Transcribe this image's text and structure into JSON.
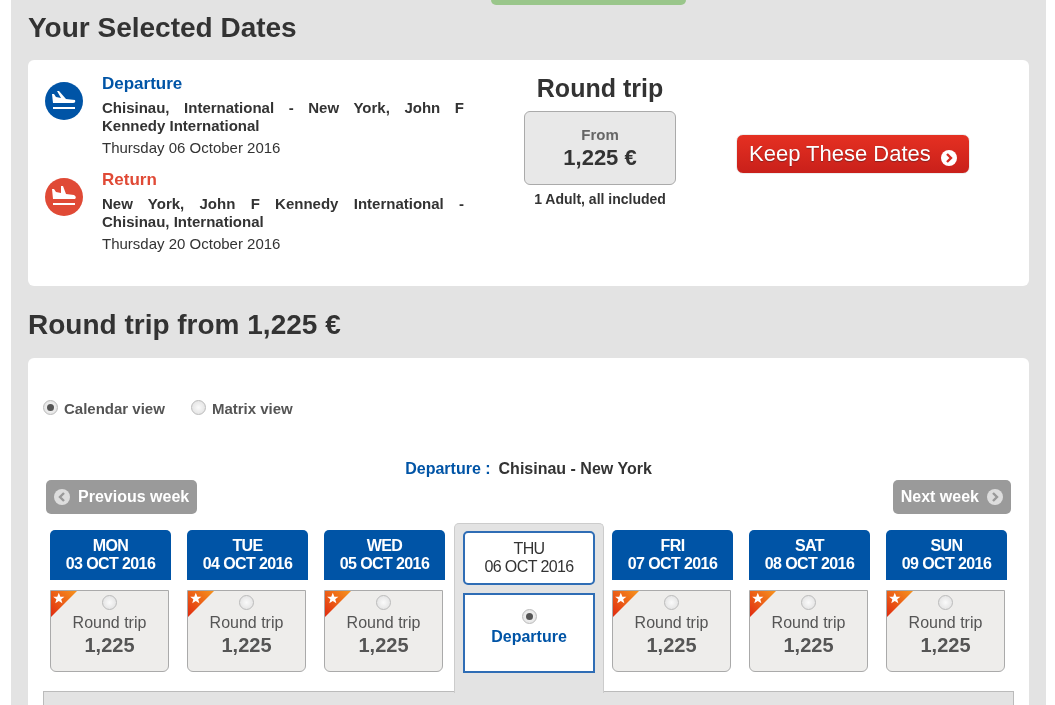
{
  "selected_dates": {
    "title": "Your Selected Dates",
    "legs": [
      {
        "kind": "departure",
        "label": "Departure",
        "route": "Chisinau, International - New York, John F Kennedy International",
        "date": "Thursday 06 October 2016"
      },
      {
        "kind": "return",
        "label": "Return",
        "route": "New York, John F Kennedy International - Chisinau, International",
        "date": "Thursday 20 October 2016"
      }
    ],
    "fare": {
      "title": "Round trip",
      "from_label": "From",
      "price": "1,225 €",
      "note": "1 Adult, all included"
    },
    "keep_button": "Keep These Dates"
  },
  "calendar": {
    "title": "Round trip from 1,225 €",
    "views": [
      {
        "label": "Calendar view",
        "selected": true
      },
      {
        "label": "Matrix view",
        "selected": false
      }
    ],
    "route_label": "Departure :",
    "route": "Chisinau - New York",
    "prev_week": "Previous week",
    "next_week": "Next week",
    "days": [
      {
        "day": "MON",
        "date": "03 OCT 2016",
        "selected": false,
        "fare_label": "Round trip",
        "price": "1,225"
      },
      {
        "day": "TUE",
        "date": "04 OCT 2016",
        "selected": false,
        "fare_label": "Round trip",
        "price": "1,225"
      },
      {
        "day": "WED",
        "date": "05 OCT 2016",
        "selected": false,
        "fare_label": "Round trip",
        "price": "1,225"
      },
      {
        "day": "THU",
        "date": "06 OCT 2016",
        "selected": true,
        "fare_label": "Departure"
      },
      {
        "day": "FRI",
        "date": "07 OCT 2016",
        "selected": false,
        "fare_label": "Round trip",
        "price": "1,225"
      },
      {
        "day": "SAT",
        "date": "08 OCT 2016",
        "selected": false,
        "fare_label": "Round trip",
        "price": "1,225"
      },
      {
        "day": "SUN",
        "date": "09 OCT 2016",
        "selected": false,
        "fare_label": "Round trip",
        "price": "1,225"
      }
    ]
  }
}
